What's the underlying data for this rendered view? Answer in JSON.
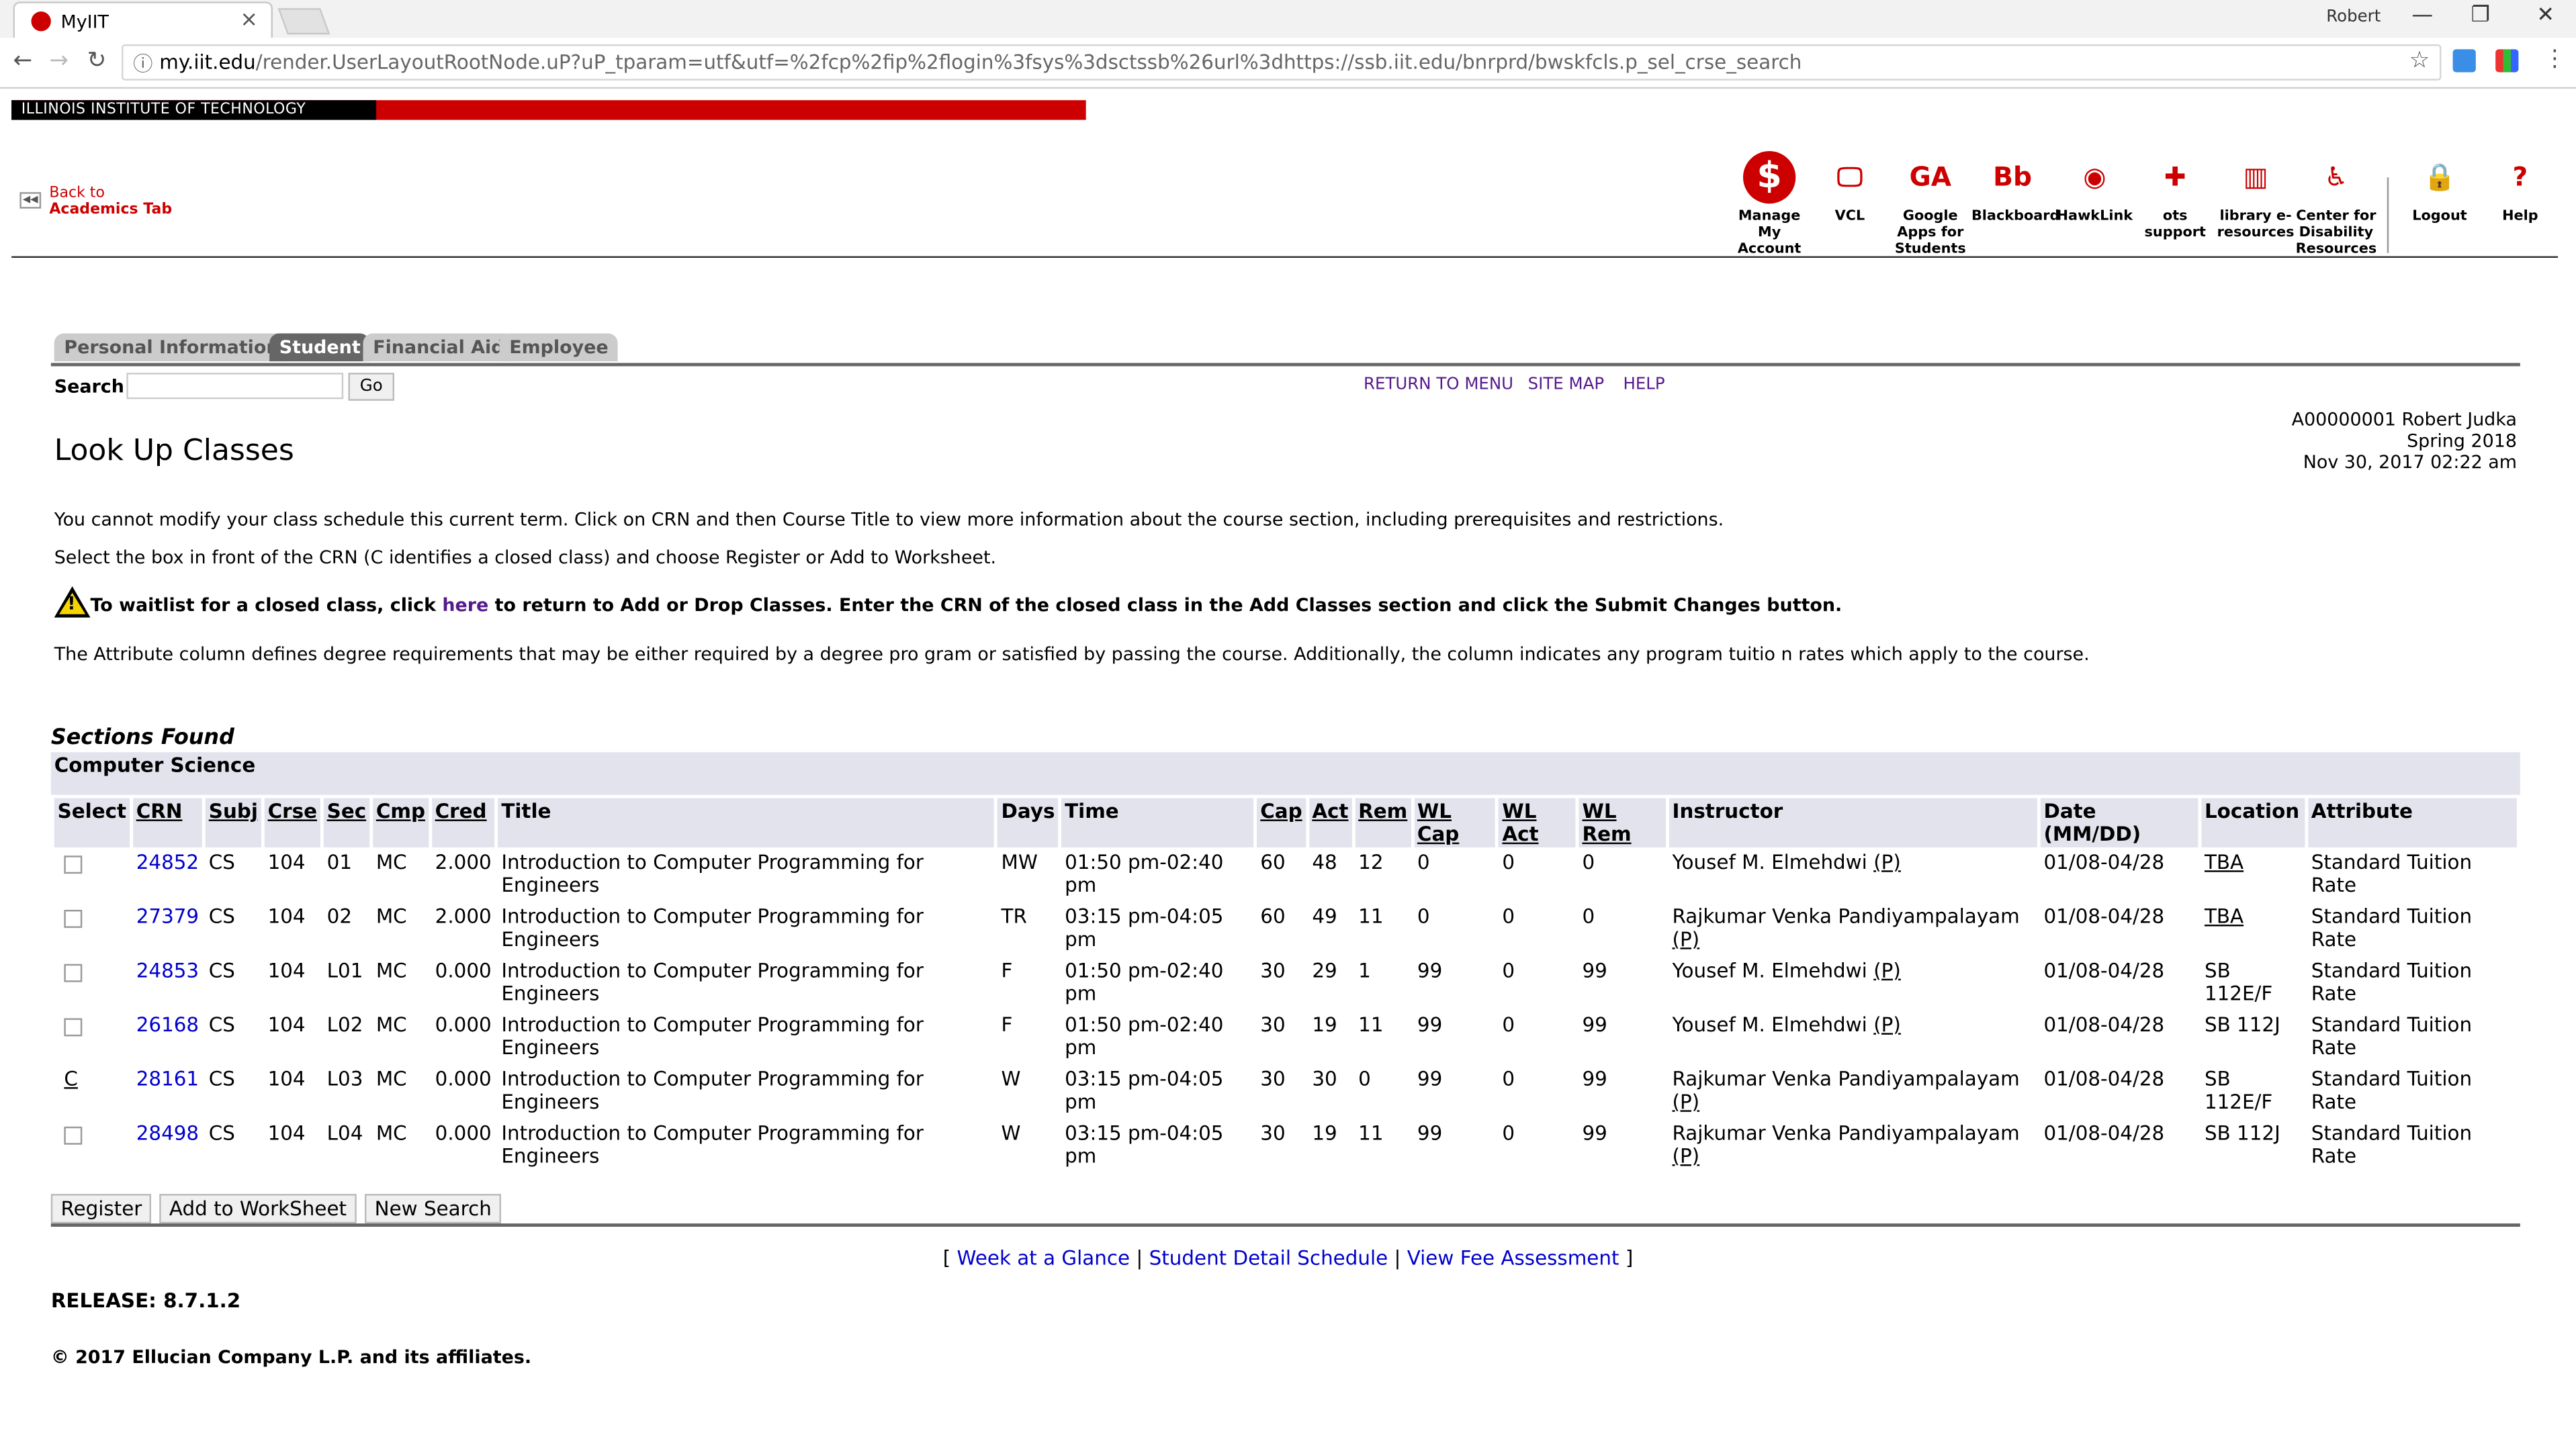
{
  "browser": {
    "tab_title": "MyIIT",
    "profile": "Robert",
    "url_domain": "my.iit.edu",
    "url_path": "/render.UserLayoutRootNode.uP?uP_tparam=utf&utf=%2fcp%2fip%2flogin%3fsys%3dsctssb%26url%3dhttps://ssb.iit.edu/bnrprd/bwskfcls.p_sel_crse_search"
  },
  "header": {
    "institution": "ILLINOIS INSTITUTE OF TECHNOLOGY",
    "back_line1": "Back to",
    "back_line2": "Academics Tab",
    "icons": [
      {
        "label": "Manage My Account",
        "icon": "dollar-icon",
        "glyph": "$"
      },
      {
        "label": "VCL",
        "icon": "monitor-icon",
        "glyph": "🖵"
      },
      {
        "label": "Google Apps for Students",
        "icon": "google-apps-icon",
        "glyph": "GA"
      },
      {
        "label": "Blackboard",
        "icon": "blackboard-icon",
        "glyph": "Bb"
      },
      {
        "label": "HawkLink",
        "icon": "hawk-icon",
        "glyph": "◉"
      },
      {
        "label": "ots support",
        "icon": "plus-icon",
        "glyph": "✚"
      },
      {
        "label": "library e-resources",
        "icon": "books-icon",
        "glyph": "▥"
      },
      {
        "label": "Center for Disability Resources",
        "icon": "accessibility-icon",
        "glyph": "♿"
      },
      {
        "label": "Logout",
        "icon": "lock-icon",
        "glyph": "🔒"
      },
      {
        "label": "Help",
        "icon": "help-icon",
        "glyph": "?"
      }
    ]
  },
  "banner_tabs": [
    "Personal Information",
    "Student",
    "Financial Aid",
    "Employee"
  ],
  "search": {
    "label": "Search",
    "go": "Go"
  },
  "top_links": [
    "RETURN TO MENU",
    "SITE MAP",
    "HELP"
  ],
  "identity": {
    "line1": "A00000001 Robert Judka",
    "line2": "Spring 2018",
    "line3": "Nov 30, 2017 02:22 am"
  },
  "page_title": "Look Up Classes",
  "info_text1": "You cannot modify your class schedule this current term. Click on CRN and then Course Title to view more information about the course section, including prerequisites and restrictions.",
  "info_text2": "Select the box in front of the CRN (C identifies a closed class) and choose Register or Add to Worksheet.",
  "warning": {
    "pre": "To waitlist for a closed class, click ",
    "link": "here",
    "post": " to return to Add or Drop Classes. Enter the CRN of the closed class in the Add Classes section and click the Submit Changes button."
  },
  "info_text4": "The Attribute column defines degree requirements that may be either required by a degree pro gram or satisfied by passing the course. Additionally, the column indicates any program tuitio n rates which apply to the course.",
  "sections_found": "Sections Found",
  "subject_header": "Computer Science",
  "table": {
    "headers": [
      "Select",
      "CRN",
      "Subj",
      "Crse",
      "Sec",
      "Cmp",
      "Cred",
      "Title",
      "Days",
      "Time",
      "Cap",
      "Act",
      "Rem",
      "WL Cap",
      "WL Act",
      "WL Rem",
      "Instructor",
      "Date (MM/DD)",
      "Location",
      "Attribute"
    ],
    "rows": [
      {
        "select": "",
        "crn": "24852",
        "subj": "CS",
        "crse": "104",
        "sec": "01",
        "cmp": "MC",
        "cred": "2.000",
        "title": "Introduction to Computer Programming for Engineers",
        "days": "MW",
        "time": "01:50 pm-02:40 pm",
        "cap": "60",
        "act": "48",
        "rem": "12",
        "wlcap": "0",
        "wlact": "0",
        "wlrem": "0",
        "instructor": "Yousef M. Elmehdwi",
        "instr_p": "(P)",
        "date": "01/08-04/28",
        "location": "TBA",
        "attribute": "Standard Tuition Rate"
      },
      {
        "select": "",
        "crn": "27379",
        "subj": "CS",
        "crse": "104",
        "sec": "02",
        "cmp": "MC",
        "cred": "2.000",
        "title": "Introduction to Computer Programming for Engineers",
        "days": "TR",
        "time": "03:15 pm-04:05 pm",
        "cap": "60",
        "act": "49",
        "rem": "11",
        "wlcap": "0",
        "wlact": "0",
        "wlrem": "0",
        "instructor": "Rajkumar Venka Pandiyampalayam",
        "instr_p": "(P)",
        "date": "01/08-04/28",
        "location": "TBA",
        "attribute": "Standard Tuition Rate"
      },
      {
        "select": "",
        "crn": "24853",
        "subj": "CS",
        "crse": "104",
        "sec": "L01",
        "cmp": "MC",
        "cred": "0.000",
        "title": "Introduction to Computer Programming for Engineers",
        "days": "F",
        "time": "01:50 pm-02:40 pm",
        "cap": "30",
        "act": "29",
        "rem": "1",
        "wlcap": "99",
        "wlact": "0",
        "wlrem": "99",
        "instructor": "Yousef M. Elmehdwi",
        "instr_p": "(P)",
        "date": "01/08-04/28",
        "location": "SB 112E/F",
        "attribute": "Standard Tuition Rate"
      },
      {
        "select": "",
        "crn": "26168",
        "subj": "CS",
        "crse": "104",
        "sec": "L02",
        "cmp": "MC",
        "cred": "0.000",
        "title": "Introduction to Computer Programming for Engineers",
        "days": "F",
        "time": "01:50 pm-02:40 pm",
        "cap": "30",
        "act": "19",
        "rem": "11",
        "wlcap": "99",
        "wlact": "0",
        "wlrem": "99",
        "instructor": "Yousef M. Elmehdwi",
        "instr_p": "(P)",
        "date": "01/08-04/28",
        "location": "SB 112J",
        "attribute": "Standard Tuition Rate"
      },
      {
        "select": "C",
        "crn": "28161",
        "subj": "CS",
        "crse": "104",
        "sec": "L03",
        "cmp": "MC",
        "cred": "0.000",
        "title": "Introduction to Computer Programming for Engineers",
        "days": "W",
        "time": "03:15 pm-04:05 pm",
        "cap": "30",
        "act": "30",
        "rem": "0",
        "wlcap": "99",
        "wlact": "0",
        "wlrem": "99",
        "instructor": "Rajkumar Venka Pandiyampalayam",
        "instr_p": "(P)",
        "date": "01/08-04/28",
        "location": "SB 112E/F",
        "attribute": "Standard Tuition Rate"
      },
      {
        "select": "",
        "crn": "28498",
        "subj": "CS",
        "crse": "104",
        "sec": "L04",
        "cmp": "MC",
        "cred": "0.000",
        "title": "Introduction to Computer Programming for Engineers",
        "days": "W",
        "time": "03:15 pm-04:05 pm",
        "cap": "30",
        "act": "19",
        "rem": "11",
        "wlcap": "99",
        "wlact": "0",
        "wlrem": "99",
        "instructor": "Rajkumar Venka Pandiyampalayam",
        "instr_p": "(P)",
        "date": "01/08-04/28",
        "location": "SB 112J",
        "attribute": "Standard Tuition Rate"
      }
    ]
  },
  "buttons": {
    "register": "Register",
    "add_worksheet": "Add to WorkSheet",
    "new_search": "New Search"
  },
  "bottom_links": [
    "Week at a Glance",
    "Student Detail Schedule",
    "View Fee Assessment"
  ],
  "release": "RELEASE: 8.7.1.2",
  "copyright": "© 2017 Ellucian Company L.P. and its affiliates."
}
